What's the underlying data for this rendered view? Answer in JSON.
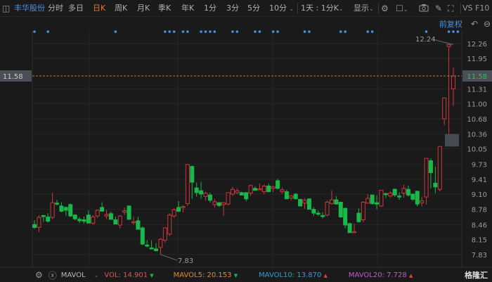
{
  "header": {
    "stock_name": "丰华股份",
    "tabs": [
      "分时",
      "多日",
      "日K",
      "周K",
      "月K",
      "季K",
      "年K",
      "1分",
      "3分",
      "5分"
    ],
    "active_tab": "日K",
    "period_dropdown": "10分",
    "multi_day_dropdown": "1天 : 1分K",
    "display_dropdown": "显示",
    "vs_label": "VS F10"
  },
  "subbar": {
    "adjust_label": "前复权"
  },
  "price_axis": {
    "ticks": [
      "12.26",
      "11.95",
      "11.31",
      "11.00",
      "10.68",
      "10.36",
      "10.05",
      "9.73",
      "9.41",
      "9.10",
      "8.78",
      "8.46",
      "8.15",
      "7.83"
    ],
    "tick_values": [
      12.26,
      11.95,
      11.31,
      11.0,
      10.68,
      10.36,
      10.05,
      9.73,
      9.41,
      9.1,
      8.78,
      8.46,
      8.15,
      7.83
    ],
    "min": 7.83,
    "max": 12.26,
    "current_price": "11.58",
    "current_value": 11.58,
    "left_label": "11.58"
  },
  "annotations": {
    "high_label": "12.24",
    "low_label": "7.83"
  },
  "colors": {
    "up": "#d0383e",
    "down": "#18b94a",
    "background": "#1a1a1a",
    "accent": "#4d8fe0",
    "dash": "#c8743a"
  },
  "chart_data": {
    "type": "candlestick",
    "ohlc": [
      [
        8.46,
        8.55,
        8.37,
        8.4
      ],
      [
        8.4,
        8.66,
        8.3,
        8.61
      ],
      [
        8.65,
        8.66,
        8.52,
        8.63
      ],
      [
        8.62,
        8.7,
        8.5,
        8.53
      ],
      [
        8.61,
        9.13,
        8.57,
        8.92
      ],
      [
        8.91,
        8.98,
        8.86,
        8.89
      ],
      [
        8.85,
        8.93,
        8.72,
        8.74
      ],
      [
        8.82,
        8.84,
        8.64,
        8.76
      ],
      [
        8.88,
        8.9,
        8.62,
        8.64
      ],
      [
        8.66,
        8.68,
        8.55,
        8.58
      ],
      [
        8.57,
        8.62,
        8.49,
        8.54
      ],
      [
        8.56,
        8.63,
        8.48,
        8.53
      ],
      [
        8.66,
        8.76,
        8.49,
        8.49
      ],
      [
        8.49,
        8.66,
        8.46,
        8.62
      ],
      [
        8.64,
        8.78,
        8.6,
        8.76
      ],
      [
        8.82,
        8.93,
        8.74,
        8.74
      ],
      [
        8.64,
        8.77,
        8.58,
        8.67
      ],
      [
        8.69,
        8.73,
        8.56,
        8.57
      ],
      [
        8.56,
        8.63,
        8.47,
        8.47
      ],
      [
        8.45,
        8.66,
        8.38,
        8.64
      ],
      [
        8.72,
        8.82,
        8.66,
        8.75
      ],
      [
        8.85,
        8.86,
        8.56,
        8.57
      ],
      [
        8.5,
        8.62,
        8.46,
        8.52
      ],
      [
        8.54,
        8.62,
        8.36,
        8.36
      ],
      [
        8.39,
        8.42,
        8.03,
        8.05
      ],
      [
        8.03,
        8.13,
        7.98,
        8.02
      ],
      [
        7.97,
        8.13,
        7.94,
        7.96
      ],
      [
        7.95,
        8.07,
        7.9,
        7.91
      ],
      [
        7.98,
        8.18,
        7.83,
        8.15
      ],
      [
        8.13,
        8.4,
        8.08,
        8.39
      ],
      [
        8.26,
        8.7,
        8.22,
        8.66
      ],
      [
        8.64,
        8.8,
        8.6,
        8.77
      ],
      [
        8.82,
        8.95,
        8.72,
        8.74
      ],
      [
        8.82,
        8.86,
        8.72,
        8.84
      ],
      [
        8.9,
        9.72,
        8.85,
        9.72
      ],
      [
        9.68,
        9.7,
        9.0,
        9.35
      ],
      [
        9.23,
        9.34,
        9.05,
        9.13
      ],
      [
        9.17,
        9.36,
        9.0,
        9.1
      ],
      [
        9.05,
        9.15,
        8.96,
        9.12
      ],
      [
        9.08,
        9.13,
        8.92,
        8.97
      ],
      [
        8.88,
        9.0,
        8.82,
        8.94
      ],
      [
        8.92,
        8.93,
        8.83,
        8.86
      ],
      [
        8.88,
        8.94,
        8.64,
        8.92
      ],
      [
        8.89,
        9.13,
        8.87,
        9.13
      ],
      [
        9.1,
        9.25,
        9.06,
        9.2
      ],
      [
        9.13,
        9.22,
        9.1,
        9.17
      ],
      [
        9.13,
        9.15,
        9.07,
        9.08
      ],
      [
        9.13,
        9.14,
        8.95,
        9.0
      ],
      [
        9.12,
        9.3,
        9.06,
        9.28
      ],
      [
        9.22,
        9.26,
        9.17,
        9.18
      ],
      [
        9.2,
        9.32,
        9.19,
        9.21
      ],
      [
        9.15,
        9.3,
        9.1,
        9.27
      ],
      [
        9.27,
        9.32,
        9.14,
        9.15
      ],
      [
        9.22,
        9.28,
        9.14,
        9.25
      ],
      [
        9.38,
        9.42,
        9.2,
        9.22
      ],
      [
        9.15,
        9.24,
        9.1,
        9.19
      ],
      [
        9.15,
        9.19,
        8.99,
        9.0
      ],
      [
        9.02,
        9.08,
        8.97,
        9.06
      ],
      [
        9.1,
        9.12,
        8.99,
        9.0
      ],
      [
        8.99,
        9.0,
        8.84,
        8.85
      ],
      [
        8.91,
        9.02,
        8.79,
        8.97
      ],
      [
        9.0,
        9.01,
        8.78,
        8.78
      ],
      [
        8.78,
        8.83,
        8.64,
        8.7
      ],
      [
        8.7,
        8.75,
        8.64,
        8.68
      ],
      [
        8.65,
        8.72,
        8.59,
        8.63
      ],
      [
        8.66,
        8.97,
        8.63,
        8.93
      ],
      [
        8.9,
        9.18,
        8.88,
        8.98
      ],
      [
        8.98,
        9.06,
        8.88,
        8.89
      ],
      [
        8.93,
        8.94,
        8.6,
        8.62
      ],
      [
        8.8,
        8.82,
        8.38,
        8.45
      ],
      [
        8.48,
        8.5,
        8.28,
        8.29
      ],
      [
        8.29,
        8.48,
        8.28,
        8.31
      ],
      [
        8.7,
        8.8,
        8.5,
        8.52
      ],
      [
        8.56,
        8.95,
        8.51,
        8.93
      ],
      [
        8.91,
        9.1,
        8.9,
        9.01
      ],
      [
        9.08,
        9.09,
        8.88,
        8.9
      ],
      [
        8.92,
        9.07,
        8.78,
        8.89
      ],
      [
        8.85,
        9.18,
        8.83,
        9.18
      ],
      [
        9.11,
        9.13,
        9.02,
        9.09
      ],
      [
        9.06,
        9.16,
        9.02,
        9.12
      ],
      [
        9.2,
        9.22,
        9.04,
        9.08
      ],
      [
        9.06,
        9.14,
        8.98,
        9.04
      ],
      [
        9.12,
        9.3,
        9.02,
        9.22
      ],
      [
        9.2,
        9.28,
        9.05,
        9.08
      ],
      [
        9.1,
        9.11,
        8.96,
        8.99
      ],
      [
        9.16,
        9.17,
        8.84,
        8.89
      ],
      [
        8.92,
        9.05,
        8.84,
        8.96
      ],
      [
        9.04,
        9.85,
        8.88,
        9.85
      ],
      [
        9.8,
        9.85,
        9.22,
        9.55
      ],
      [
        9.33,
        9.68,
        9.12,
        9.25
      ],
      [
        9.2,
        10.1,
        9.16,
        10.1
      ],
      [
        10.68,
        11.12,
        10.55,
        11.12
      ],
      [
        12.2,
        12.26,
        10.36,
        12.24
      ],
      [
        11.31,
        11.75,
        10.95,
        11.58
      ]
    ],
    "event_marker_indices": [
      0,
      3,
      18,
      29,
      30,
      31,
      33,
      34,
      37,
      38,
      39,
      40,
      44,
      45,
      49,
      50,
      53,
      54,
      60,
      61,
      68,
      69,
      74,
      75,
      87,
      92,
      93,
      94
    ],
    "highlighted_index": 93,
    "highlight_range": [
      10.1,
      10.36
    ]
  },
  "indicator_bar": {
    "name": "MAVOL",
    "items": [
      {
        "label": "VOL:",
        "value": "14.901",
        "trend": "▼",
        "color": "#e0545e"
      },
      {
        "label": "MAVOL5:",
        "value": "20.153",
        "trend": "▼",
        "color": "#e88a2a"
      },
      {
        "label": "MAVOL10:",
        "value": "13.870",
        "trend": "▲",
        "color": "#2f9fd6"
      },
      {
        "label": "MAVOL20:",
        "value": "7.728",
        "trend": "▲",
        "color": "#c05bc6"
      }
    ]
  },
  "logo": "格隆汇"
}
